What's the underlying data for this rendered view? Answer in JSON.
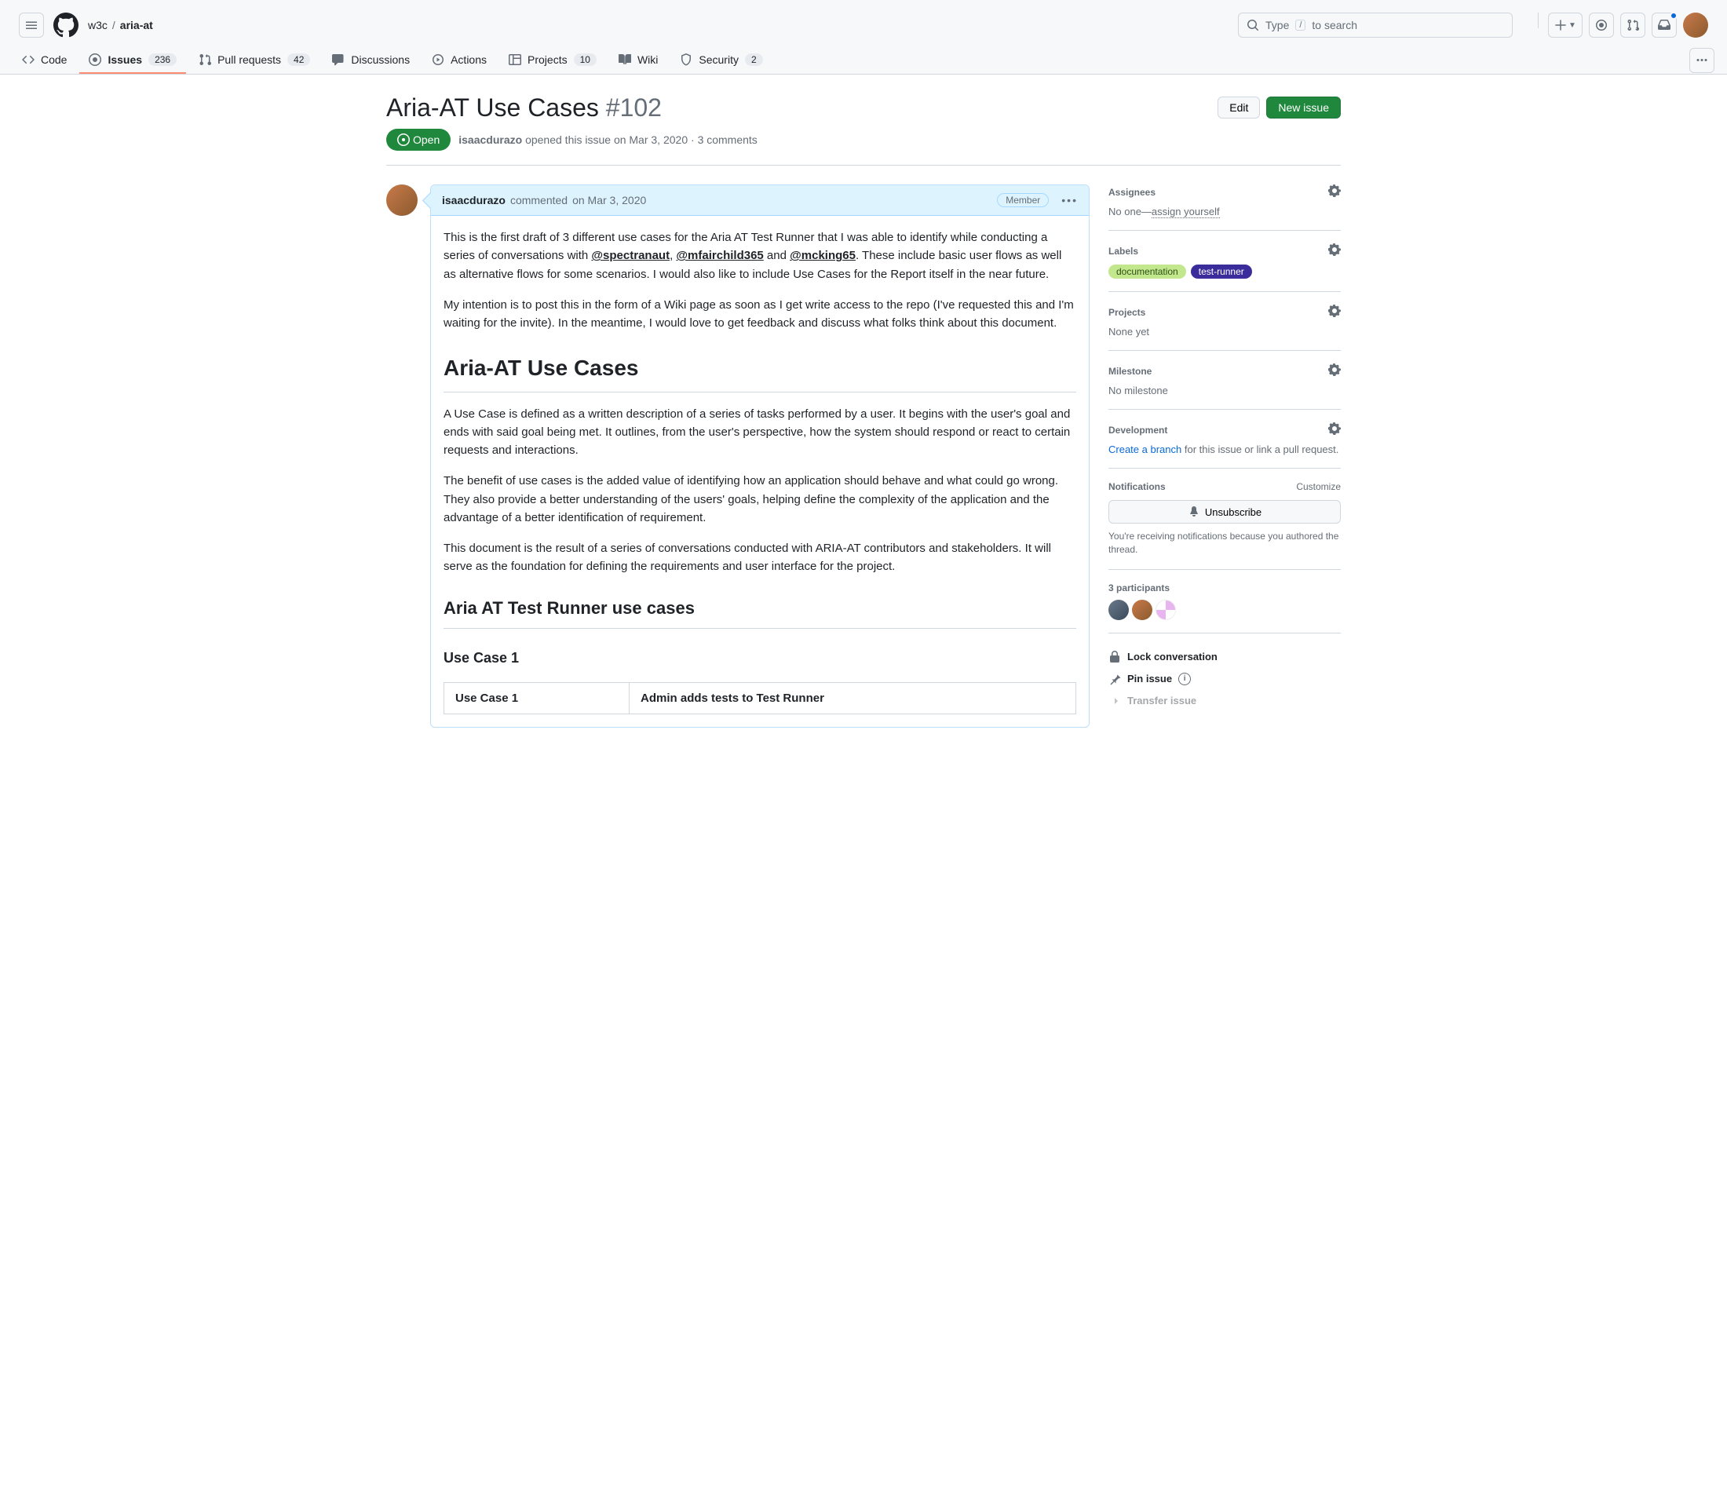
{
  "breadcrumb": {
    "owner": "w3c",
    "repo": "aria-at"
  },
  "search": {
    "prefix": "Type",
    "key": "/",
    "suffix": "to search"
  },
  "tabs": {
    "code": "Code",
    "issues": {
      "label": "Issues",
      "count": "236"
    },
    "prs": {
      "label": "Pull requests",
      "count": "42"
    },
    "discussions": "Discussions",
    "actions": "Actions",
    "projects": {
      "label": "Projects",
      "count": "10"
    },
    "wiki": "Wiki",
    "security": {
      "label": "Security",
      "count": "2"
    }
  },
  "issue": {
    "title": "Aria-AT Use Cases",
    "number": "#102",
    "edit": "Edit",
    "new": "New issue",
    "state": "Open",
    "author": "isaacdurazo",
    "opened_mid": " opened this issue ",
    "opened_date": "on Mar 3, 2020",
    "comments": "3 comments"
  },
  "comment": {
    "author": "isaacdurazo",
    "verb": " commented ",
    "date": "on Mar 3, 2020",
    "role": "Member",
    "p1a": "This is the first draft of 3 different use cases for the Aria AT Test Runner that I was able to identify while conducting a series of conversations with ",
    "m1": "@spectranaut",
    "p1b": ", ",
    "m2": "@mfairchild365",
    "p1c": " and ",
    "m3": "@mcking65",
    "p1d": ". These include basic user flows as well as alternative flows for some scenarios. I would also like to include Use Cases for the Report itself in the near future.",
    "p2": "My intention is to post this in the form of a Wiki page as soon as I get write access to the repo (I've requested this and I'm waiting for the invite). In the meantime, I would love to get feedback and discuss what folks think about this document.",
    "h1": "Aria-AT Use Cases",
    "p3": "A Use Case is defined as a written description of a series of tasks performed by a user. It begins with the user's goal and ends with said goal being met. It outlines, from the user's perspective, how the system should respond or react to certain requests and interactions.",
    "p4": "The benefit of use cases is the added value of identifying how an application should behave and what could go wrong. They also provide a better understanding of the users' goals, helping define the complexity of the application and the advantage of a better identification of requirement.",
    "p5": "This document is the result of a series of conversations conducted with ARIA-AT contributors and stakeholders. It will serve as the foundation for defining the requirements and user interface for the project.",
    "h2": "Aria AT Test Runner use cases",
    "h3": "Use Case 1",
    "th1": "Use Case 1",
    "td1": "Admin adds tests to Test Runner"
  },
  "sidebar": {
    "assignees": {
      "title": "Assignees",
      "none": "No one—",
      "assign": "assign yourself"
    },
    "labels": {
      "title": "Labels",
      "doc": "documentation",
      "tr": "test-runner"
    },
    "projects": {
      "title": "Projects",
      "none": "None yet"
    },
    "milestone": {
      "title": "Milestone",
      "none": "No milestone"
    },
    "development": {
      "title": "Development",
      "create": "Create a branch",
      "rest": " for this issue or link a pull request."
    },
    "notifications": {
      "title": "Notifications",
      "customize": "Customize",
      "unsubscribe": "Unsubscribe",
      "desc": "You're receiving notifications because you authored the thread."
    },
    "participants": "3 participants",
    "actions": {
      "lock": "Lock conversation",
      "pin": "Pin issue",
      "transfer": "Transfer issue"
    }
  }
}
